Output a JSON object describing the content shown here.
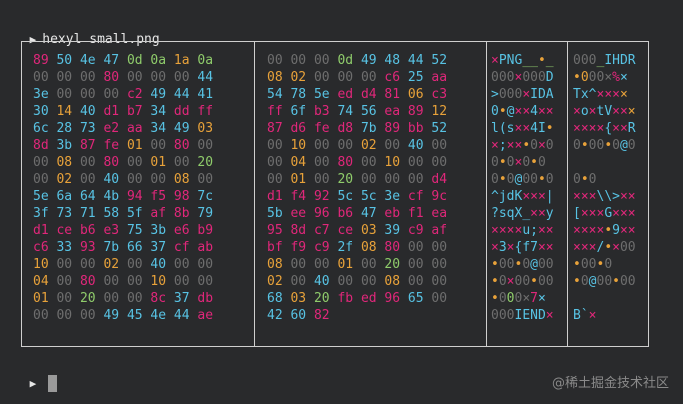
{
  "terminal": {
    "prompt_glyph": "▶",
    "command": "hexyl small.png",
    "second_prompt_glyph": "▶"
  },
  "colors": {
    "null": "#6e6e6e",
    "ascii_printable": "#58c3e4",
    "ascii_whitespace": "#8fcc6b",
    "ascii_other": "#e8a23a",
    "non_ascii": "#e0277a",
    "frame": "#cfcfcf",
    "background": "#292a2c"
  },
  "hexdump": {
    "rows": [
      {
        "hex": "89 50 4e 47 0d 0a 1a 0a 00 00 00 0d 49 48 44 52",
        "ascii": "×PNG__•_ 000_IHDR"
      },
      {
        "hex": "00 00 00 80 00 00 00 44 08 02 00 00 00 c6 25 aa",
        "ascii": "000×000D •000×%×"
      },
      {
        "hex": "3e 00 00 00 c2 49 44 41 54 78 5e ed d4 81 06 c3",
        "ascii": ">000×IDA Tx^××××"
      },
      {
        "hex": "30 14 40 d1 b7 34 dd ff ff 6f b3 74 56 ea 89 12",
        "ascii": "0•@××4×× ×o×tV×××"
      },
      {
        "hex": "6c 28 73 e2 aa 34 49 03 87 d6 fe d8 7b 89 bb 52",
        "ascii": "l(s××4I• ××××{××R"
      },
      {
        "hex": "8d 3b 87 fe 01 00 80 00 00 10 00 00 02 00 40 00",
        "ascii": "×;××•0×0 0•00•0@0"
      },
      {
        "hex": "00 08 00 80 00 01 00 20 00 04 00 80 00 10 00 00",
        "ascii": "0•0×0•0  0•0×0•00"
      },
      {
        "hex": "00 02 00 40 00 00 08 00 00 01 00 20 00 00 00 d4",
        "ascii": "0•0@00•0 0•0 000×"
      },
      {
        "hex": "5e 6a 64 4b 94 f5 98 7c d1 f4 92 5c 5c 3e cf 9c",
        "ascii": "^jdK×××| ×××\\\\>××"
      },
      {
        "hex": "3f 73 71 58 5f af 8b 79 5b ee 96 b6 47 eb f1 ea",
        "ascii": "?sqX_××y [×××G×××"
      },
      {
        "hex": "d1 ce b6 e3 75 3b e6 b9 95 8d c7 ce 03 39 c9 af",
        "ascii": "××××u;×× ××××•9××"
      },
      {
        "hex": "c6 33 93 7b 66 37 cf ab bf f9 c9 2f 08 80 00 00",
        "ascii": "×3×{f7×× ×××/•×00"
      },
      {
        "hex": "10 00 00 02 00 40 00 00 08 00 00 01 00 20 00 00",
        "ascii": "•00•0@00 •00•0 00"
      },
      {
        "hex": "04 00 80 00 00 10 00 00 02 00 40 00 00 08 00 00",
        "ascii": "•0×00•00 •0@00•00"
      },
      {
        "hex": "01 00 20 00 00 8c 37 db 68 03 20 fb ed 96 65 00",
        "ascii": "•0 00×7× h• ×××e0"
      },
      {
        "hex": "00 00 00 49 45 4e 44 ae 42 60 82",
        "ascii": "000IEND× B`×"
      }
    ]
  },
  "watermark": "@稀土掘金技术社区"
}
